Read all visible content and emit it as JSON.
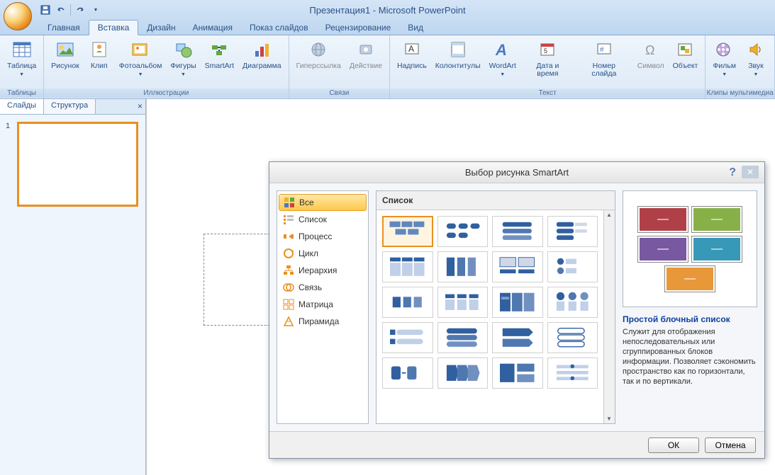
{
  "title": "Презентация1 - Microsoft PowerPoint",
  "tabs": [
    "Главная",
    "Вставка",
    "Дизайн",
    "Анимация",
    "Показ слайдов",
    "Рецензирование",
    "Вид"
  ],
  "active_tab": 1,
  "ribbon": {
    "g0": {
      "label": "Таблицы",
      "items": [
        "Таблица"
      ]
    },
    "g1": {
      "label": "Иллюстрации",
      "items": [
        "Рисунок",
        "Клип",
        "Фотоальбом",
        "Фигуры",
        "SmartArt",
        "Диаграмма"
      ]
    },
    "g2": {
      "label": "Связи",
      "items": [
        "Гиперссылка",
        "Действие"
      ]
    },
    "g3": {
      "label": "Текст",
      "items": [
        "Надпись",
        "Колонтитулы",
        "WordArt",
        "Дата и время",
        "Номер слайда",
        "Символ",
        "Объект"
      ]
    },
    "g4": {
      "label": "Клипы мультимедиа",
      "items": [
        "Фильм",
        "Звук"
      ]
    }
  },
  "sidepanel": {
    "tabs": [
      "Слайды",
      "Структура"
    ],
    "thumb_num": "1"
  },
  "dialog": {
    "title": "Выбор рисунка SmartArt",
    "help": "?",
    "categories": [
      "Все",
      "Список",
      "Процесс",
      "Цикл",
      "Иерархия",
      "Связь",
      "Матрица",
      "Пирамида"
    ],
    "gallery_header": "Список",
    "preview_title": "Простой блочный список",
    "preview_desc": "Служит для отображения непоследовательных или сгруппированных блоков информации. Позволяет сэкономить пространство как по горизонтали, так и по вертикали.",
    "ok": "ОК",
    "cancel": "Отмена"
  }
}
